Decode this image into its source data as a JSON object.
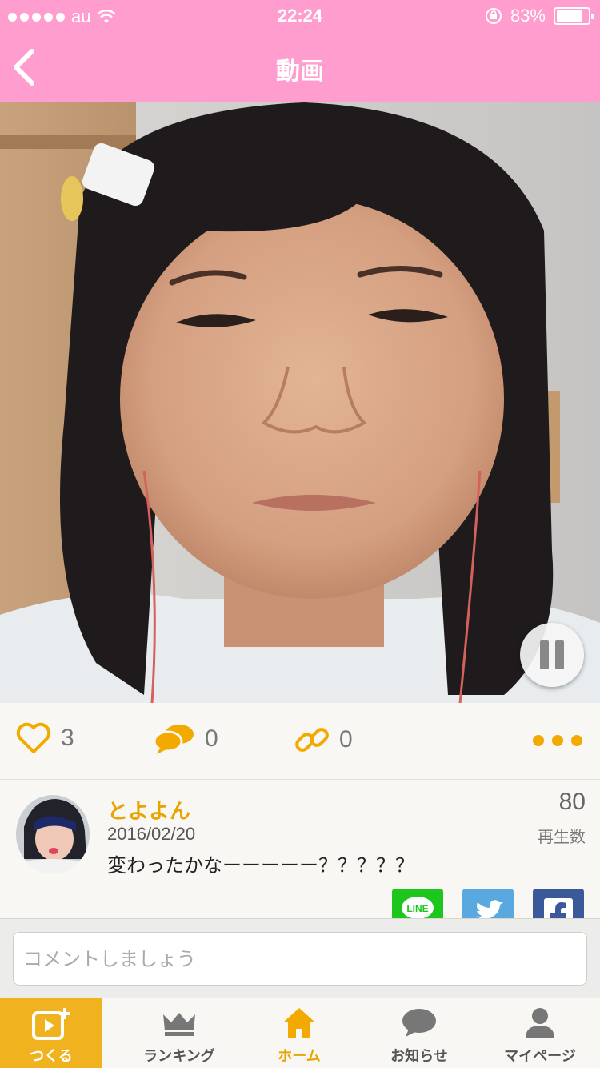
{
  "status_bar": {
    "carrier": "au",
    "time": "22:24",
    "battery_percent": "83%",
    "battery_level": 0.83
  },
  "nav": {
    "title": "動画",
    "back_icon": "chevron-left-icon"
  },
  "video": {
    "state": "playing",
    "pause_icon": "pause-icon"
  },
  "actions": {
    "likes": "3",
    "comments": "0",
    "links": "0",
    "like_icon": "heart-icon",
    "comment_icon": "speech-bubbles-icon",
    "link_icon": "chain-link-icon",
    "more_icon": "ellipsis-icon"
  },
  "post": {
    "username": "とよよん",
    "date": "2016/02/20",
    "message": "変わったかなーーーーー？？？？？",
    "play_count": "80",
    "play_label": "再生数",
    "share": [
      {
        "name": "LINE",
        "color": "#1dc61d",
        "label": "LINE"
      },
      {
        "name": "Twitter",
        "color": "#5aa8e0"
      },
      {
        "name": "Facebook",
        "color": "#3b5898"
      }
    ]
  },
  "comment": {
    "placeholder": "コメントしましょう"
  },
  "tabs": [
    {
      "label": "つくる",
      "icon": "video-plus-icon"
    },
    {
      "label": "ランキング",
      "icon": "crown-icon"
    },
    {
      "label": "ホーム",
      "icon": "home-icon"
    },
    {
      "label": "お知らせ",
      "icon": "speech-bubble-icon"
    },
    {
      "label": "マイページ",
      "icon": "user-icon"
    }
  ],
  "colors": {
    "header_pink": "#ff9dce",
    "accent_yellow": "#f2a900",
    "create_tab": "#f0b21f"
  }
}
